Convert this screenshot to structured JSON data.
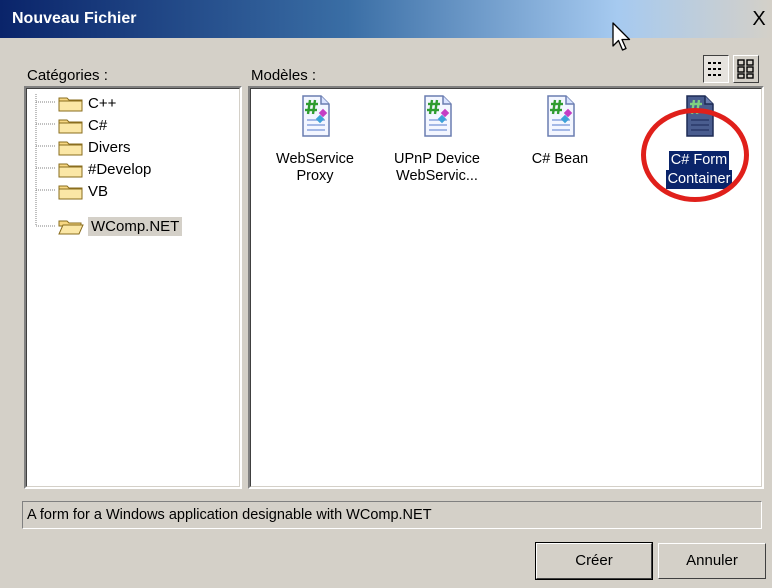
{
  "window": {
    "title": "Nouveau Fichier",
    "close_symbol": "X"
  },
  "labels": {
    "categories": "Catégories :",
    "templates": "Modèles :"
  },
  "categories": [
    {
      "label": "C++",
      "icon": "folder-icon",
      "selected": false
    },
    {
      "label": "C#",
      "icon": "folder-icon",
      "selected": false
    },
    {
      "label": "Divers",
      "icon": "folder-icon",
      "selected": false
    },
    {
      "label": "#Develop",
      "icon": "folder-icon",
      "selected": false
    },
    {
      "label": "VB",
      "icon": "folder-icon",
      "selected": false
    },
    {
      "label": "WComp.NET",
      "icon": "folder-open-icon",
      "selected": true
    }
  ],
  "templates": [
    {
      "line1": "WebService",
      "line2": "Proxy",
      "selected": false
    },
    {
      "line1": "UPnP Device",
      "line2": "WebServic...",
      "selected": false
    },
    {
      "line1": "C# Bean",
      "line2": "",
      "selected": false
    },
    {
      "line1": "C# Form",
      "line2": "Container",
      "selected": true
    }
  ],
  "description": "A form for a Windows application designable with WComp.NET",
  "buttons": {
    "create": "Créer",
    "cancel": "Annuler"
  },
  "view_modes": [
    {
      "icon": "large-icons-view-icon",
      "active": true
    },
    {
      "icon": "list-view-icon",
      "active": false
    }
  ],
  "colors": {
    "dialog_bg": "#d4d0c8",
    "title_gradient_start": "#0a246a",
    "selection": "#0a246a",
    "highlight_circle": "#e0201b"
  }
}
